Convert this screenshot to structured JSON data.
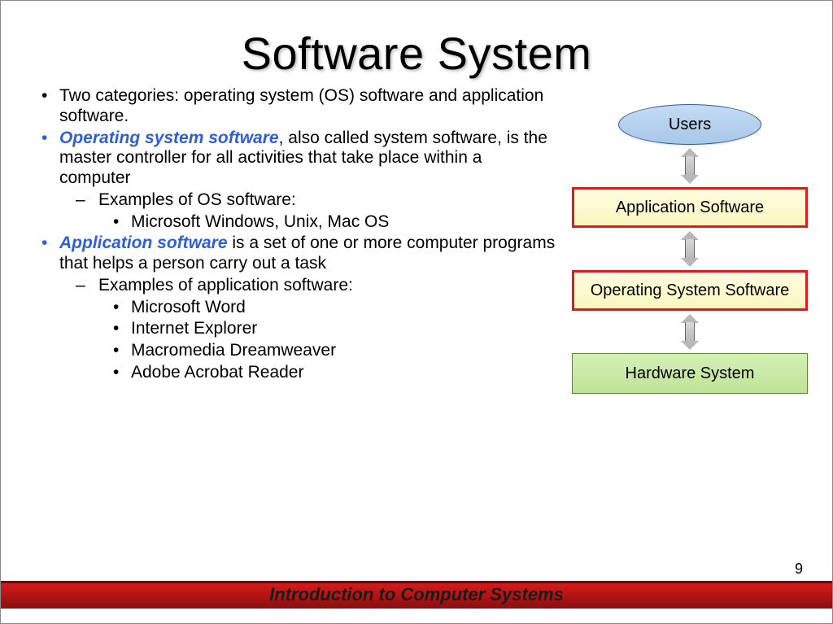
{
  "title": "Software System",
  "bullets": {
    "b1": "Two categories:  operating system (OS) software and application software.",
    "b2_emph": "Operating system software",
    "b2_rest": ", also called system software, is the master controller for all activities that take place within a computer",
    "b2a": "Examples of OS software:",
    "b2a1": "Microsoft Windows, Unix, Mac OS",
    "b3_emph": "Application software",
    "b3_rest": " is a set of one or more computer programs that helps a person carry out a task",
    "b3a": "Examples of application software:",
    "b3a1": "Microsoft Word",
    "b3a2": "Internet Explorer",
    "b3a3": "Macromedia Dreamweaver",
    "b3a4": "Adobe Acrobat Reader"
  },
  "diagram": {
    "users": "Users",
    "app": "Application Software",
    "os": "Operating System Software",
    "hw": "Hardware System"
  },
  "page_number": "9",
  "footer": "Introduction to Computer Systems"
}
